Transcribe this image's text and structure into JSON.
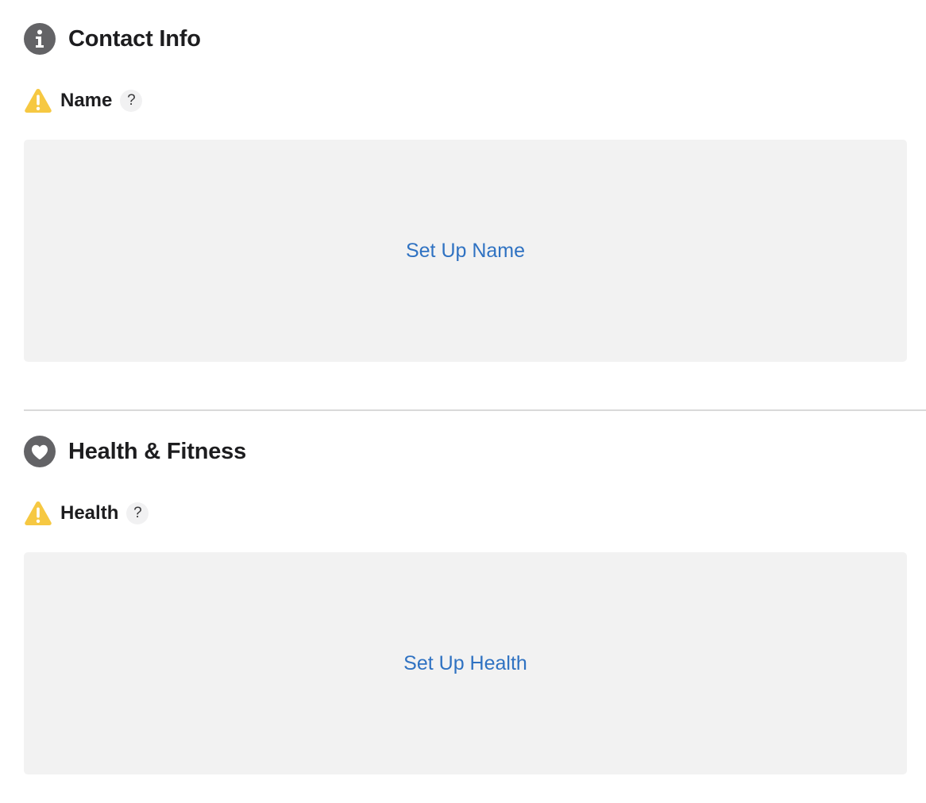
{
  "sections": [
    {
      "icon": "info-icon",
      "title": "Contact Info",
      "field": {
        "status_icon": "warning-icon",
        "label": "Name",
        "help": "?",
        "action_label": "Set Up Name"
      }
    },
    {
      "icon": "heart-icon",
      "title": "Health & Fitness",
      "field": {
        "status_icon": "warning-icon",
        "label": "Health",
        "help": "?",
        "action_label": "Set Up Health"
      }
    }
  ],
  "colors": {
    "section_icon_bg": "#636366",
    "warning": "#f6c842",
    "link": "#2f72c2",
    "panel_bg": "#f2f2f2",
    "divider": "#d9d9d9"
  }
}
